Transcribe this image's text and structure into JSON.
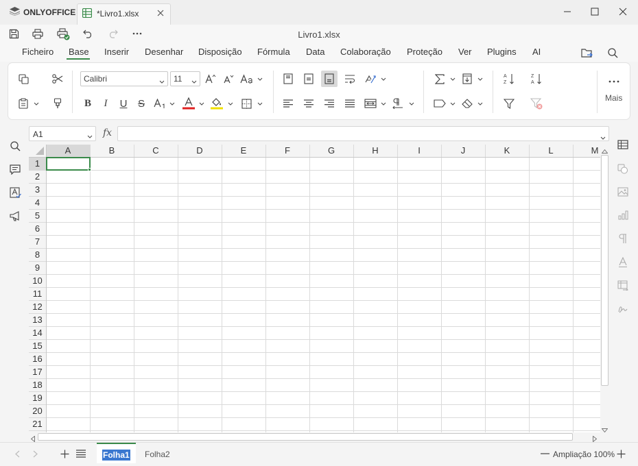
{
  "app": {
    "brand": "ONLYOFFICE",
    "tab_title": "*Livro1.xlsx",
    "doc_title": "Livro1.xlsx"
  },
  "window_controls": [
    "minimize-icon",
    "maximize-icon",
    "close-icon"
  ],
  "quick_access": [
    "save-icon",
    "print-icon",
    "quick-print-icon",
    "undo-icon",
    "redo-icon",
    "more-icon"
  ],
  "menu": {
    "items": [
      "Ficheiro",
      "Base",
      "Inserir",
      "Desenhar",
      "Disposição",
      "Fórmula",
      "Data",
      "Colaboração",
      "Proteção",
      "Ver",
      "Plugins",
      "AI"
    ],
    "active": "Base"
  },
  "ribbon": {
    "font_name": "Calibri",
    "font_size": "11",
    "more_label": "Mais",
    "colors": {
      "font_color": "#e02020",
      "fill_color": "#f0e000",
      "accent": "#3a8a4a"
    }
  },
  "formula_bar": {
    "name_box": "A1",
    "fx_label": "fx",
    "formula": ""
  },
  "sheet": {
    "columns": [
      "A",
      "B",
      "C",
      "D",
      "E",
      "F",
      "G",
      "H",
      "I",
      "J",
      "K",
      "L",
      "M"
    ],
    "rows": [
      "1",
      "2",
      "3",
      "4",
      "5",
      "6",
      "7",
      "8",
      "9",
      "10",
      "11",
      "12",
      "13",
      "14",
      "15",
      "16",
      "17",
      "18",
      "19",
      "20",
      "21"
    ],
    "selected_cell": "A1"
  },
  "sheet_tabs": [
    {
      "label": "Folha1",
      "active": true
    },
    {
      "label": "Folha2",
      "active": false
    }
  ],
  "status": {
    "zoom_label": "Ampliação 100%"
  }
}
